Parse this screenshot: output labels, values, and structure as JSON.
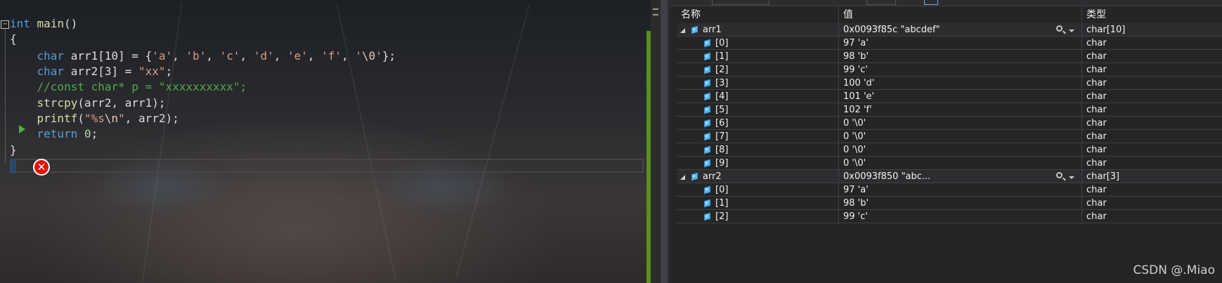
{
  "editor": {
    "lines": [
      [
        [
          "kw",
          "int"
        ],
        [
          "id",
          " "
        ],
        [
          "fn",
          "main"
        ],
        [
          "id",
          "()"
        ]
      ],
      [
        [
          "id",
          "{"
        ]
      ],
      [
        [
          "id",
          "    "
        ],
        [
          "kw",
          "char"
        ],
        [
          "id",
          " arr1[10] = {"
        ],
        [
          "str",
          "'a'"
        ],
        [
          "id",
          ", "
        ],
        [
          "str",
          "'b'"
        ],
        [
          "id",
          ", "
        ],
        [
          "str",
          "'c'"
        ],
        [
          "id",
          ", "
        ],
        [
          "str",
          "'d'"
        ],
        [
          "id",
          ", "
        ],
        [
          "str",
          "'e'"
        ],
        [
          "id",
          ", "
        ],
        [
          "str",
          "'f'"
        ],
        [
          "id",
          ", "
        ],
        [
          "str",
          "'"
        ],
        [
          "esc",
          "\\0"
        ],
        [
          "str",
          "'"
        ],
        [
          "id",
          "};"
        ]
      ],
      [
        [
          "id",
          "    "
        ],
        [
          "kw",
          "char"
        ],
        [
          "id",
          " arr2[3] = "
        ],
        [
          "str",
          "\"xx\""
        ],
        [
          "id",
          ";"
        ]
      ],
      [
        [
          "id",
          "    "
        ],
        [
          "cmt",
          "//const char* p = \"xxxxxxxxxx\";"
        ]
      ],
      [
        [
          "id",
          "    "
        ],
        [
          "fn",
          "strcpy"
        ],
        [
          "id",
          "(arr2, arr1);"
        ]
      ],
      [
        [
          "id",
          "    "
        ],
        [
          "fn",
          "printf"
        ],
        [
          "id",
          "("
        ],
        [
          "str",
          "\"%s"
        ],
        [
          "esc",
          "\\n"
        ],
        [
          "str",
          "\""
        ],
        [
          "id",
          ", arr2);"
        ]
      ],
      [
        [
          "id",
          "    "
        ],
        [
          "kw",
          "return"
        ],
        [
          "id",
          " "
        ],
        [
          "num",
          "0"
        ],
        [
          "id",
          ";"
        ]
      ],
      [
        [
          "id",
          "}"
        ]
      ]
    ],
    "fold_glyph": "−",
    "error_glyph": "✕"
  },
  "watch": {
    "columns": {
      "name": "名称",
      "value": "值",
      "type": "类型"
    },
    "rows": [
      {
        "kind": "parent",
        "name": "arr1",
        "value": "0x0093f85c \"abcdef\"",
        "type": "char[10]"
      },
      {
        "kind": "child",
        "name": "[0]",
        "value": "97 'a'",
        "type": "char"
      },
      {
        "kind": "child",
        "name": "[1]",
        "value": "98 'b'",
        "type": "char"
      },
      {
        "kind": "child",
        "name": "[2]",
        "value": "99 'c'",
        "type": "char"
      },
      {
        "kind": "child",
        "name": "[3]",
        "value": "100 'd'",
        "type": "char"
      },
      {
        "kind": "child",
        "name": "[4]",
        "value": "101 'e'",
        "type": "char"
      },
      {
        "kind": "child",
        "name": "[5]",
        "value": "102 'f'",
        "type": "char"
      },
      {
        "kind": "child",
        "name": "[6]",
        "value": "0 '\\0'",
        "type": "char"
      },
      {
        "kind": "child",
        "name": "[7]",
        "value": "0 '\\0'",
        "type": "char"
      },
      {
        "kind": "child",
        "name": "[8]",
        "value": "0 '\\0'",
        "type": "char"
      },
      {
        "kind": "child",
        "name": "[9]",
        "value": "0 '\\0'",
        "type": "char"
      },
      {
        "kind": "parent",
        "name": "arr2",
        "value": "0x0093f850 \"abc...",
        "type": "char[3]"
      },
      {
        "kind": "child",
        "name": "[0]",
        "value": "97 'a'",
        "type": "char"
      },
      {
        "kind": "child",
        "name": "[1]",
        "value": "98 'b'",
        "type": "char"
      },
      {
        "kind": "child",
        "name": "[2]",
        "value": "99 'c'",
        "type": "char"
      }
    ]
  },
  "watermark": "CSDN @.Miao",
  "colors": {
    "keyword": "#569cd6",
    "function": "#dcdcaa",
    "string": "#d69d85",
    "comment": "#57a64a",
    "number": "#b5cea8",
    "error": "#e51400",
    "change_bar": "#5a8f1e",
    "watch_bg": "#252526"
  }
}
